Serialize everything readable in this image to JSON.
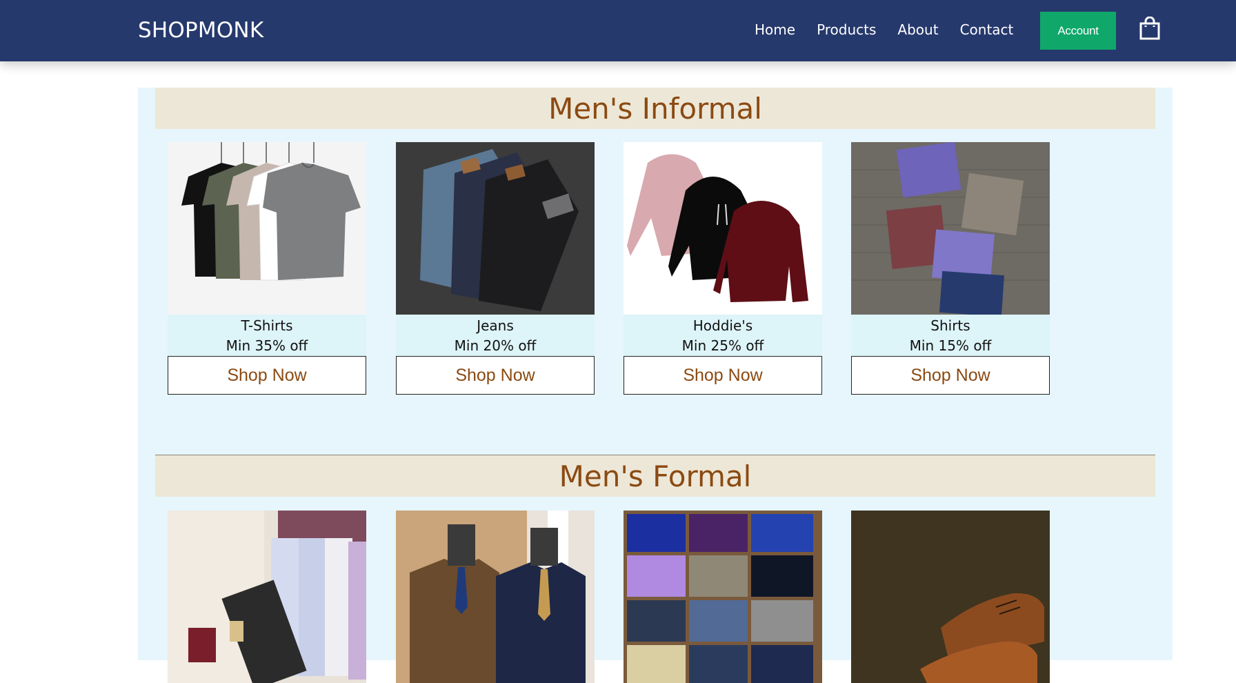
{
  "navbar": {
    "brand": "SHOPMONK",
    "links": [
      "Home",
      "Products",
      "About",
      "Contact"
    ],
    "account_label": "Account",
    "bag_icon": "shopping-bag-icon"
  },
  "sections": [
    {
      "title": "Men's Informal",
      "items": [
        {
          "name": "T-Shirts",
          "offer": "Min 35% off",
          "button": "Shop Now"
        },
        {
          "name": "Jeans",
          "offer": "Min 20% off",
          "button": "Shop Now"
        },
        {
          "name": "Hoddie's",
          "offer": "Min 25% off",
          "button": "Shop Now"
        },
        {
          "name": "Shirts",
          "offer": "Min 15% off",
          "button": "Shop Now"
        }
      ]
    },
    {
      "title": "Men's Formal",
      "items": [
        {
          "image": "formal-shirts-suitcase"
        },
        {
          "image": "suits-on-mannequins"
        },
        {
          "image": "folded-trousers"
        },
        {
          "image": "leather-shoes"
        }
      ]
    }
  ],
  "colors": {
    "navbar": "#26396d",
    "account_button": "#0fa86a",
    "content_bg": "#e6f6fc",
    "title_bg": "#ede7d7",
    "title_text": "#8b4a12"
  }
}
